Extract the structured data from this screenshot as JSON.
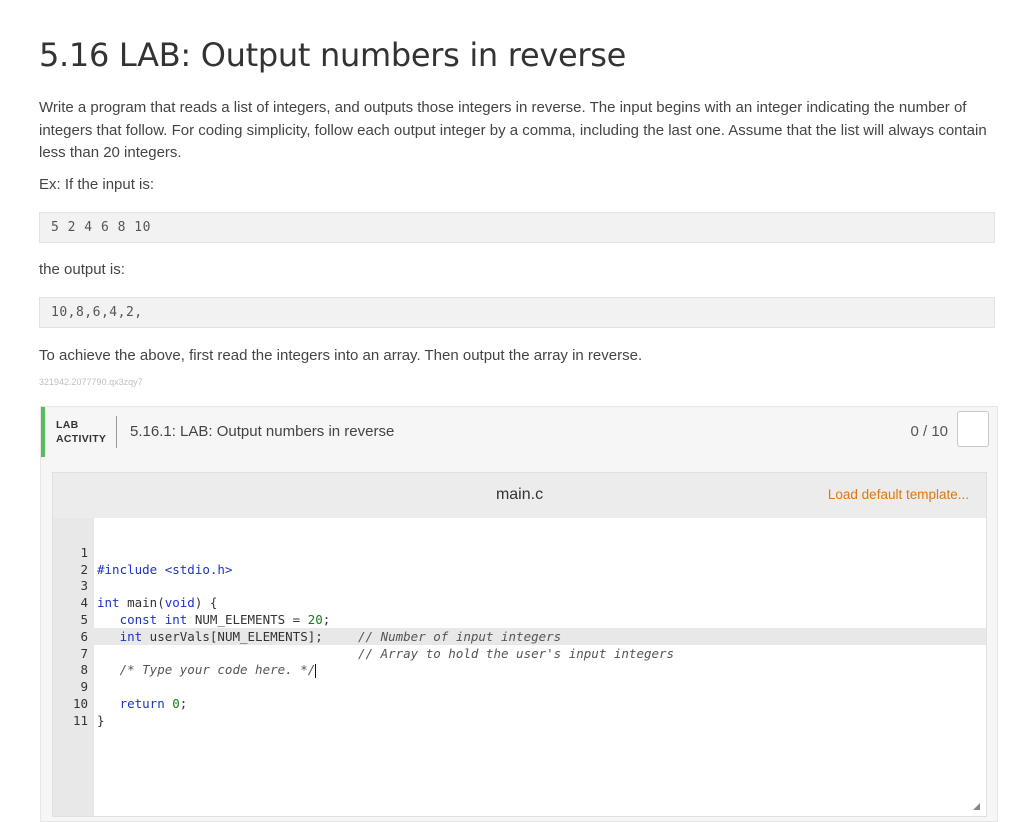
{
  "title": "5.16 LAB: Output numbers in reverse",
  "description": "Write a program that reads a list of integers, and outputs those integers in reverse. The input begins with an integer indicating the number of integers that follow. For coding simplicity, follow each output integer by a comma, including the last one. Assume that the list will always contain less than 20 integers.",
  "example_intro": "Ex: If the input is:",
  "example_input": "5 2 4 6 8 10",
  "output_intro": "the output is:",
  "example_output": "10,8,6,4,2,",
  "hint": "To achieve the above, first read the integers into an array. Then output the array in reverse.",
  "activity_id": "321942.2077790.qx3zqy7",
  "lab": {
    "tag_line1": "LAB",
    "tag_line2": "ACTIVITY",
    "name": "5.16.1: LAB: Output numbers in reverse",
    "score": "0 / 10"
  },
  "editor": {
    "filename": "main.c",
    "load_default": "Load default template...",
    "line_numbers": [
      "1",
      "2",
      "3",
      "4",
      "5",
      "6",
      "7",
      "8",
      "9",
      "10",
      "11"
    ],
    "code": {
      "l1_include": "#include <stdio.h>",
      "l3_int": "int",
      "l3_main": " main(",
      "l3_void": "void",
      "l3_close": ") {",
      "l4_indent": "   ",
      "l4_const": "const int",
      "l4_decl": " NUM_ELEMENTS = ",
      "l4_num": "20",
      "l4_semi": ";",
      "l4_comment": "// Number of input integers",
      "l5_int": "int",
      "l5_decl": " userVals[NUM_ELEMENTS];",
      "l5_comment": "// Array to hold the user's input integers",
      "l7_comment": "/* Type your code here. */",
      "l9_return": "return",
      "l9_num": "0",
      "l9_semi": ";",
      "l10_brace": "}"
    }
  },
  "colors": {
    "accent_green": "#5cb85c",
    "link_orange": "#e0780c",
    "keyword_blue": "#1e32c8",
    "number_green": "#1a7a1a"
  }
}
